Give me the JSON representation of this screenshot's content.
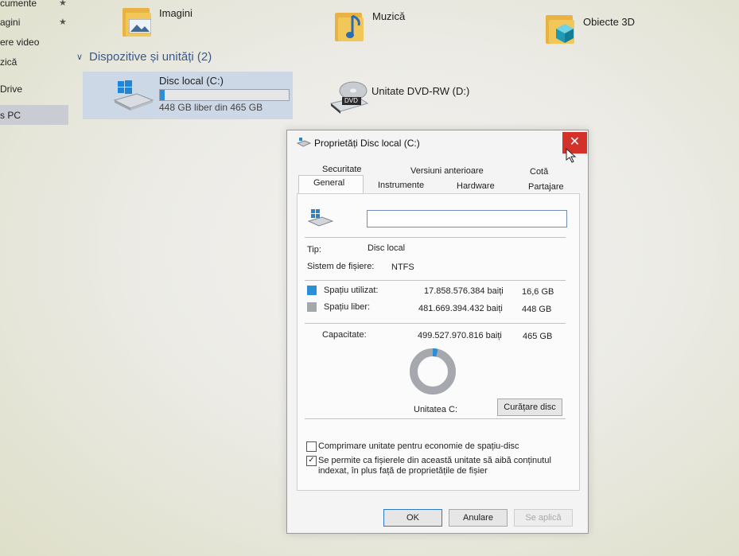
{
  "sidebar": {
    "items": [
      {
        "label": "cumente"
      },
      {
        "label": "agini"
      },
      {
        "label": "ere video"
      },
      {
        "label": "zică"
      },
      {
        "label": "Drive"
      },
      {
        "label": "s PC"
      }
    ],
    "pin_glyph": "★"
  },
  "folders": [
    {
      "label": "Imagini",
      "icon": "pictures-folder-icon"
    },
    {
      "label": "Muzică",
      "icon": "music-folder-icon"
    },
    {
      "label": "Obiecte 3D",
      "icon": "3d-objects-folder-icon"
    }
  ],
  "devices": {
    "header": "Dispozitive și unități (2)",
    "local_disk": {
      "name": "Disc local (C:)",
      "space_text": "448 GB liber din 465 GB",
      "used_fraction": 0.036
    },
    "dvd": {
      "name": "Unitate DVD-RW (D:)",
      "badge": "DVD"
    }
  },
  "dialog": {
    "title": "Proprietăți Disc local (C:)",
    "close_glyph": "✕",
    "tabs_row1": [
      "Securitate",
      "Versiuni anterioare",
      "Cotă"
    ],
    "tabs_row2": [
      "General",
      "Instrumente",
      "Hardware",
      "Partajare"
    ],
    "name_value": "",
    "type_label": "Tip:",
    "type_value": "Disc local",
    "fs_label": "Sistem de fișiere:",
    "fs_value": "NTFS",
    "used_label": "Spațiu utilizat:",
    "used_bytes": "17.858.576.384 baiți",
    "used_size": "16,6 GB",
    "free_label": "Spațiu liber:",
    "free_bytes": "481.669.394.432 baiți",
    "free_size": "448 GB",
    "capacity_label": "Capacitate:",
    "capacity_bytes": "499.527.970.816 baiți",
    "capacity_size": "465 GB",
    "drive_label": "Unitatea C:",
    "cleanup_button": "Curățare disc",
    "compress_label": "Comprimare unitate pentru economie de spațiu-disc",
    "compress_checked": false,
    "index_label_1": "Se permite ca fișierele din această unitate să aibă conținutul",
    "index_label_2": "indexat, în plus față de proprietățile de fișier",
    "index_checked": true,
    "ok_button": "OK",
    "cancel_button": "Anulare",
    "apply_button": "Se aplică",
    "check_glyph": "✓",
    "used_fraction": 0.036
  },
  "colors": {
    "used": "#2b8fd8",
    "free": "#a5a9ae",
    "accent": "#3a5a8c",
    "close": "#d5312b"
  }
}
